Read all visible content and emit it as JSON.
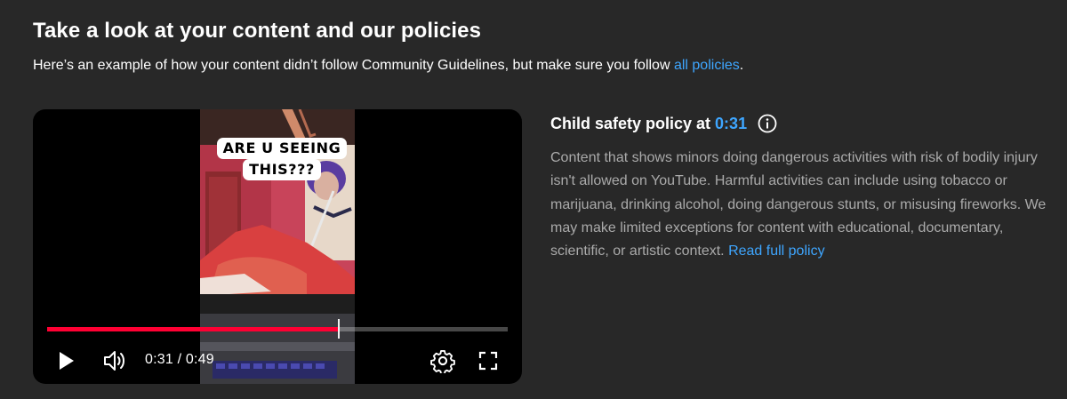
{
  "header": {
    "title": "Take a look at your content and our policies",
    "subtitle_prefix": "Here’s an example of how your content didn’t follow Community Guidelines, but make sure you follow ",
    "subtitle_link": "all policies",
    "subtitle_suffix": "."
  },
  "video": {
    "caption_line1": "ARE U SEEING",
    "caption_line2": "THIS???",
    "progress_fraction": 0.6327,
    "time_display": "0:31 / 0:49",
    "accent_color": "#ff0033"
  },
  "policy": {
    "title_prefix": "Child safety policy at",
    "timestamp": "0:31",
    "body": "Content that shows minors doing dangerous activities with risk of bodily injury isn't allowed on YouTube. Harmful activities can include using tobacco or marijuana, drinking alcohol, doing dangerous stunts, or misusing fireworks. We may make limited exceptions for content with educational, documentary, scientific, or artistic context. ",
    "read_more": "Read full policy",
    "link_color": "#3ea6ff"
  },
  "icons": {
    "play": "play-icon",
    "volume": "volume-icon",
    "settings": "gear-icon",
    "fullscreen": "fullscreen-icon",
    "info": "info-icon"
  }
}
